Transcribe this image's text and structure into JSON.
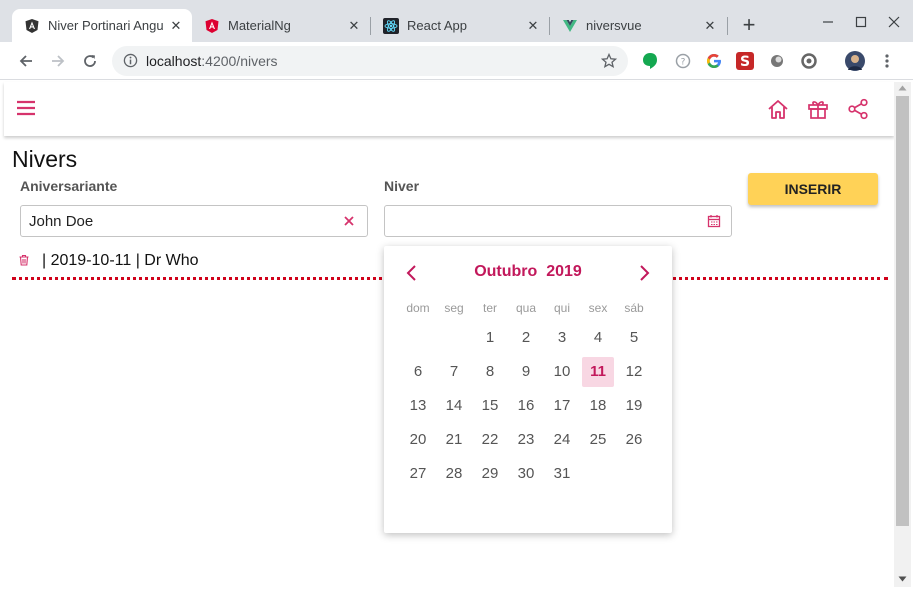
{
  "browser": {
    "tabs": [
      {
        "title": "Niver Portinari Angu",
        "icon": "angular-logo-icon",
        "active": true
      },
      {
        "title": "MaterialNg",
        "icon": "angular-red-logo-icon",
        "active": false
      },
      {
        "title": "React App",
        "icon": "react-logo-icon",
        "active": false
      },
      {
        "title": "niversvue",
        "icon": "vue-logo-icon",
        "active": false
      }
    ],
    "url_host": "localhost",
    "url_path": ":4200/nivers"
  },
  "app": {
    "title": "Nivers",
    "colors": {
      "accent": "#d6336c",
      "button": "#ffd257",
      "dotted": "#d0021b"
    },
    "form": {
      "aniversariante_label": "Aniversariante",
      "aniversariante_value": "John Doe",
      "niver_label": "Niver",
      "niver_value": "",
      "insert_label": "INSERIR"
    },
    "list": [
      {
        "text": "| 2019-10-11 | Dr Who"
      }
    ],
    "calendar": {
      "month_label": "Outubro  2019",
      "weekdays": [
        "dom",
        "seg",
        "ter",
        "qua",
        "qui",
        "sex",
        "sáb"
      ],
      "selected_day": 11,
      "first_weekday": 2,
      "days_in_month": 31
    }
  }
}
